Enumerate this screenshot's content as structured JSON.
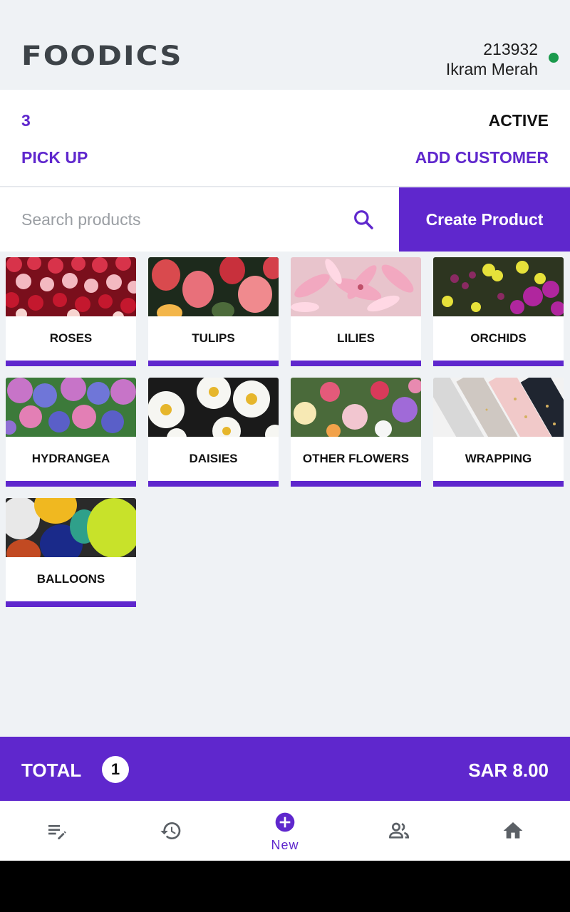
{
  "header": {
    "logo_text": "FOODICS",
    "user_id": "213932",
    "user_name": "Ikram Merah",
    "status_color": "#1a9a4c"
  },
  "order": {
    "number": "3",
    "status": "ACTIVE",
    "type": "PICK UP",
    "add_customer_label": "ADD CUSTOMER"
  },
  "search": {
    "placeholder": "Search products",
    "value": ""
  },
  "create_product_label": "Create Product",
  "categories": [
    {
      "label": "ROSES",
      "image": "roses"
    },
    {
      "label": "TULIPS",
      "image": "tulips"
    },
    {
      "label": "LILIES",
      "image": "lilies"
    },
    {
      "label": "ORCHIDS",
      "image": "orchids"
    },
    {
      "label": "HYDRANGEA",
      "image": "hydrangea"
    },
    {
      "label": "DAISIES",
      "image": "daisies"
    },
    {
      "label": "OTHER FLOWERS",
      "image": "other-flowers"
    },
    {
      "label": "WRAPPING",
      "image": "wrapping"
    },
    {
      "label": "BALLOONS",
      "image": "balloons"
    }
  ],
  "total": {
    "label": "TOTAL",
    "count": "1",
    "amount": "SAR 8.00"
  },
  "bottom_nav": {
    "items": [
      {
        "icon": "order-edit-icon"
      },
      {
        "icon": "history-icon"
      },
      {
        "icon": "add-circle-icon",
        "label": "New"
      },
      {
        "icon": "customers-icon"
      },
      {
        "icon": "home-icon"
      }
    ]
  },
  "colors": {
    "accent": "#5f27cd",
    "background": "#eff2f5",
    "nav_icon": "#5b6066"
  }
}
